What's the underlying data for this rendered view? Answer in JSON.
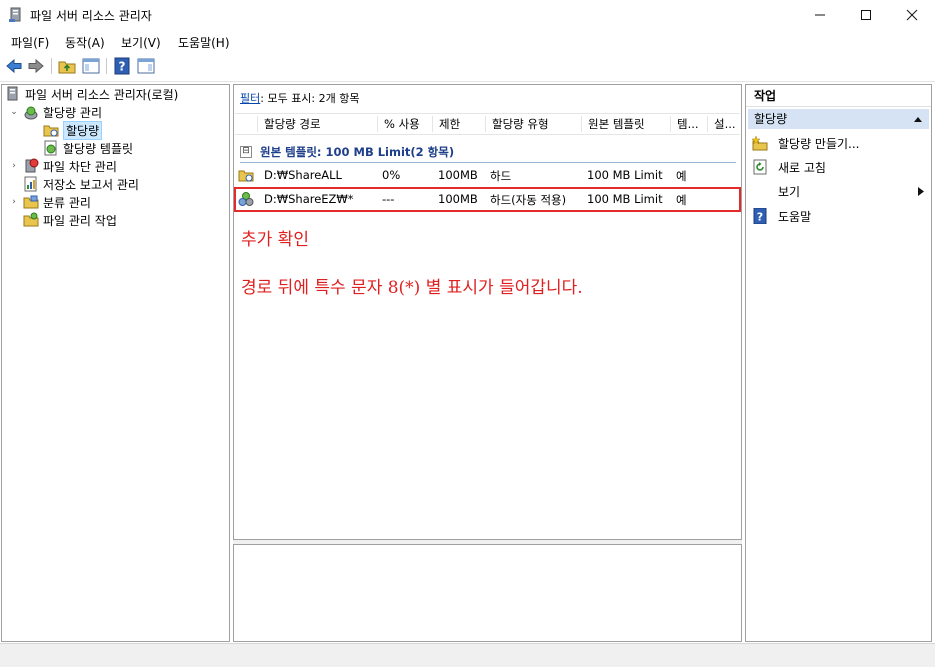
{
  "window": {
    "title": "파일 서버 리소스 관리자"
  },
  "menu": [
    "파일(F)",
    "동작(A)",
    "보기(V)",
    "도움말(H)"
  ],
  "tree": {
    "root": "파일 서버 리소스 관리자(로컬)",
    "items": [
      {
        "label": "할당량 관리",
        "expanded": true
      },
      {
        "label": "할당량",
        "selected": true
      },
      {
        "label": "할당량 템플릿"
      },
      {
        "label": "파일 차단 관리"
      },
      {
        "label": "저장소 보고서 관리"
      },
      {
        "label": "분류 관리"
      },
      {
        "label": "파일 관리 작업"
      }
    ]
  },
  "list": {
    "filter_link": "필터",
    "filter_text": ": 모두 표시: 2개 항목",
    "columns": [
      "할당량 경로",
      "% 사용",
      "제한",
      "할당량 유형",
      "원본 템플릿",
      "템...",
      "설..."
    ],
    "group_label": "원본 템플릿: 100 MB Limit(2 항목)",
    "group_toggle": "⊟",
    "rows": [
      {
        "path": "D:₩ShareALL",
        "used": "0%",
        "limit": "100MB",
        "type": "하드",
        "template": "100 MB Limit",
        "match": "예"
      },
      {
        "path": "D:₩ShareEZ₩*",
        "used": "---",
        "limit": "100MB",
        "type": "하드(자동 적용)",
        "template": "100 MB Limit",
        "match": "예"
      }
    ]
  },
  "annotations": {
    "note1": "추가 확인",
    "note2": "경로 뒤에 특수 문자 8(*) 별 표시가 들어갑니다."
  },
  "actions": {
    "header": "작업",
    "section": "할당량",
    "items": [
      "할당량 만들기...",
      "새로 고침",
      "보기",
      "도움말"
    ]
  }
}
